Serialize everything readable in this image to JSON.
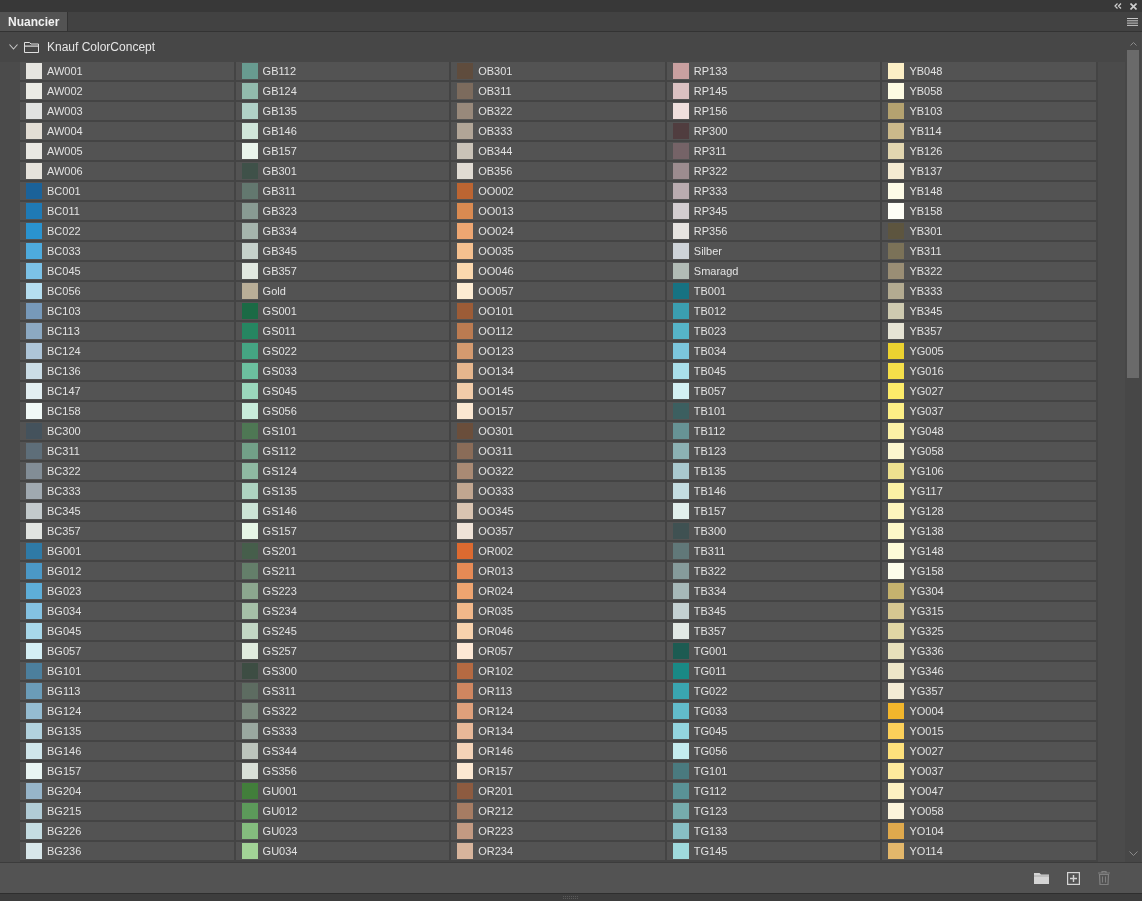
{
  "window": {
    "tabs": [
      {
        "label": "Nuancier",
        "selected": true
      }
    ]
  },
  "group": {
    "name": "Knauf ColorConcept",
    "expanded": true,
    "columns": [
      {
        "swatches": [
          {
            "name": "AW001",
            "color": "#e6e5e0"
          },
          {
            "name": "AW002",
            "color": "#ebebe5"
          },
          {
            "name": "AW003",
            "color": "#e1e2e1"
          },
          {
            "name": "AW004",
            "color": "#e3ded5"
          },
          {
            "name": "AW005",
            "color": "#e9e8e3"
          },
          {
            "name": "AW006",
            "color": "#e6e3dc"
          },
          {
            "name": "BC001",
            "color": "#1b6299"
          },
          {
            "name": "BC011",
            "color": "#1f7ab5"
          },
          {
            "name": "BC022",
            "color": "#2a93cf"
          },
          {
            "name": "BC033",
            "color": "#4eabdd"
          },
          {
            "name": "BC045",
            "color": "#7cc2e7"
          },
          {
            "name": "BC056",
            "color": "#b5def0"
          },
          {
            "name": "BC103",
            "color": "#7799b9"
          },
          {
            "name": "BC113",
            "color": "#8ca9c2"
          },
          {
            "name": "BC124",
            "color": "#aec5d8"
          },
          {
            "name": "BC136",
            "color": "#cbdde6"
          },
          {
            "name": "BC147",
            "color": "#e3eff2"
          },
          {
            "name": "BC158",
            "color": "#f1f9f7"
          },
          {
            "name": "BC300",
            "color": "#44525c"
          },
          {
            "name": "BC311",
            "color": "#5e6e79"
          },
          {
            "name": "BC322",
            "color": "#828d96"
          },
          {
            "name": "BC333",
            "color": "#a0a9b0"
          },
          {
            "name": "BC345",
            "color": "#c3cacc"
          },
          {
            "name": "BC357",
            "color": "#e1e4e1"
          },
          {
            "name": "BG001",
            "color": "#2f7aa6"
          },
          {
            "name": "BG012",
            "color": "#4b98c6"
          },
          {
            "name": "BG023",
            "color": "#5eaed8"
          },
          {
            "name": "BG034",
            "color": "#84c2e2"
          },
          {
            "name": "BG045",
            "color": "#a8d8ea"
          },
          {
            "name": "BG057",
            "color": "#d4eff5"
          },
          {
            "name": "BG101",
            "color": "#4c7f9d"
          },
          {
            "name": "BG113",
            "color": "#6b9cb8"
          },
          {
            "name": "BG124",
            "color": "#95bcd1"
          },
          {
            "name": "BG135",
            "color": "#b2d2de"
          },
          {
            "name": "BG146",
            "color": "#d0e6eb"
          },
          {
            "name": "BG157",
            "color": "#e9f5f3"
          },
          {
            "name": "BG204",
            "color": "#97b5c9"
          },
          {
            "name": "BG215",
            "color": "#b1ccd6"
          },
          {
            "name": "BG226",
            "color": "#c5dde2"
          },
          {
            "name": "BG236",
            "color": "#d8e7ea"
          }
        ]
      },
      {
        "swatches": [
          {
            "name": "GB112",
            "color": "#689b90"
          },
          {
            "name": "GB124",
            "color": "#92bbad"
          },
          {
            "name": "GB135",
            "color": "#b0d1c7"
          },
          {
            "name": "GB146",
            "color": "#d0e6da"
          },
          {
            "name": "GB157",
            "color": "#eaf5ec"
          },
          {
            "name": "GB301",
            "color": "#3f5149"
          },
          {
            "name": "GB311",
            "color": "#63786f"
          },
          {
            "name": "GB323",
            "color": "#899b93"
          },
          {
            "name": "GB334",
            "color": "#a6b5ad"
          },
          {
            "name": "GB345",
            "color": "#c6d1cb"
          },
          {
            "name": "GB357",
            "color": "#e1e8e0"
          },
          {
            "name": "Gold",
            "color": "#b9ae98"
          },
          {
            "name": "GS001",
            "color": "#1b6a45"
          },
          {
            "name": "GS011",
            "color": "#268661"
          },
          {
            "name": "GS022",
            "color": "#45a583"
          },
          {
            "name": "GS033",
            "color": "#6cc09f"
          },
          {
            "name": "GS045",
            "color": "#9bd8bd"
          },
          {
            "name": "GS056",
            "color": "#c8ecdb"
          },
          {
            "name": "GS101",
            "color": "#4e7754"
          },
          {
            "name": "GS112",
            "color": "#72a088"
          },
          {
            "name": "GS124",
            "color": "#8fb9a2"
          },
          {
            "name": "GS135",
            "color": "#aed3c1"
          },
          {
            "name": "GS146",
            "color": "#cce4d6"
          },
          {
            "name": "GS157",
            "color": "#e6f6e6"
          },
          {
            "name": "GS201",
            "color": "#465e4b"
          },
          {
            "name": "GS211",
            "color": "#647f6a"
          },
          {
            "name": "GS223",
            "color": "#8ca78f"
          },
          {
            "name": "GS234",
            "color": "#a6c0a8"
          },
          {
            "name": "GS245",
            "color": "#c3d7c5"
          },
          {
            "name": "GS257",
            "color": "#e0ebde"
          },
          {
            "name": "GS300",
            "color": "#3d4d43"
          },
          {
            "name": "GS311",
            "color": "#5d6c61"
          },
          {
            "name": "GS322",
            "color": "#7b8a7e"
          },
          {
            "name": "GS333",
            "color": "#9aa8a0"
          },
          {
            "name": "GS344",
            "color": "#bcc4bc"
          },
          {
            "name": "GS356",
            "color": "#d9e0d8"
          },
          {
            "name": "GU001",
            "color": "#427e3b"
          },
          {
            "name": "GU012",
            "color": "#5c9a5a"
          },
          {
            "name": "GU023",
            "color": "#84bd7e"
          },
          {
            "name": "GU034",
            "color": "#a2d397"
          }
        ]
      },
      {
        "swatches": [
          {
            "name": "OB301",
            "color": "#5f4c3d"
          },
          {
            "name": "OB311",
            "color": "#7c6b5d"
          },
          {
            "name": "OB322",
            "color": "#98897b"
          },
          {
            "name": "OB333",
            "color": "#b1a597"
          },
          {
            "name": "OB344",
            "color": "#cac3b8"
          },
          {
            "name": "OB356",
            "color": "#e0dbd3"
          },
          {
            "name": "OO002",
            "color": "#bc6532"
          },
          {
            "name": "OO013",
            "color": "#d98a51"
          },
          {
            "name": "OO024",
            "color": "#eda672"
          },
          {
            "name": "OO035",
            "color": "#f5c08f"
          },
          {
            "name": "OO046",
            "color": "#fbd8ae"
          },
          {
            "name": "OO057",
            "color": "#fdecd3"
          },
          {
            "name": "OO101",
            "color": "#9c5c37"
          },
          {
            "name": "OO112",
            "color": "#bb7b51"
          },
          {
            "name": "OO123",
            "color": "#d49a6f"
          },
          {
            "name": "OO134",
            "color": "#e6b68d"
          },
          {
            "name": "OO145",
            "color": "#f2cca9"
          },
          {
            "name": "OO157",
            "color": "#fbe7d1"
          },
          {
            "name": "OO301",
            "color": "#6a4e3b"
          },
          {
            "name": "OO311",
            "color": "#8a6c58"
          },
          {
            "name": "OO322",
            "color": "#a98a74"
          },
          {
            "name": "OO333",
            "color": "#c1a690"
          },
          {
            "name": "OO345",
            "color": "#d9c4b1"
          },
          {
            "name": "OO357",
            "color": "#efe3d8"
          },
          {
            "name": "OR002",
            "color": "#dc6a30"
          },
          {
            "name": "OR013",
            "color": "#e68a55"
          },
          {
            "name": "OR024",
            "color": "#eea470"
          },
          {
            "name": "OR035",
            "color": "#f2b88a"
          },
          {
            "name": "OR046",
            "color": "#f8d2ad"
          },
          {
            "name": "OR057",
            "color": "#fde8d5"
          },
          {
            "name": "OR102",
            "color": "#b56a42"
          },
          {
            "name": "OR113",
            "color": "#cf8660"
          },
          {
            "name": "OR124",
            "color": "#dfa07b"
          },
          {
            "name": "OR134",
            "color": "#e8b898"
          },
          {
            "name": "OR146",
            "color": "#f4d3b8"
          },
          {
            "name": "OR157",
            "color": "#fce8d2"
          },
          {
            "name": "OR201",
            "color": "#8d5b40"
          },
          {
            "name": "OR212",
            "color": "#a67c63"
          },
          {
            "name": "OR223",
            "color": "#c39a82"
          },
          {
            "name": "OR234",
            "color": "#d7b49c"
          }
        ]
      },
      {
        "swatches": [
          {
            "name": "RP133",
            "color": "#c9a0a0"
          },
          {
            "name": "RP145",
            "color": "#dbc1c2"
          },
          {
            "name": "RP156",
            "color": "#efdfdd"
          },
          {
            "name": "RP300",
            "color": "#503d3f"
          },
          {
            "name": "RP311",
            "color": "#756367"
          },
          {
            "name": "RP322",
            "color": "#9c8c8f"
          },
          {
            "name": "RP333",
            "color": "#b9abaf"
          },
          {
            "name": "RP345",
            "color": "#d3cdd0"
          },
          {
            "name": "RP356",
            "color": "#e6e3e0"
          },
          {
            "name": "Silber",
            "color": "#ced3d8"
          },
          {
            "name": "Smaragd",
            "color": "#b1bbb5"
          },
          {
            "name": "TB001",
            "color": "#177282"
          },
          {
            "name": "TB012",
            "color": "#3b9eb0"
          },
          {
            "name": "TB023",
            "color": "#56b4c8"
          },
          {
            "name": "TB034",
            "color": "#7cc6dc"
          },
          {
            "name": "TB045",
            "color": "#a9dfea"
          },
          {
            "name": "TB057",
            "color": "#d3f0f3"
          },
          {
            "name": "TB101",
            "color": "#3c5f60"
          },
          {
            "name": "TB112",
            "color": "#679395"
          },
          {
            "name": "TB123",
            "color": "#8cb1b3"
          },
          {
            "name": "TB135",
            "color": "#a9c9cf"
          },
          {
            "name": "TB146",
            "color": "#c4dde1"
          },
          {
            "name": "TB157",
            "color": "#e1efec"
          },
          {
            "name": "TB300",
            "color": "#3f5152"
          },
          {
            "name": "TB311",
            "color": "#617879"
          },
          {
            "name": "TB322",
            "color": "#869b9b"
          },
          {
            "name": "TB334",
            "color": "#a6b8b8"
          },
          {
            "name": "TB345",
            "color": "#c4d1d2"
          },
          {
            "name": "TB357",
            "color": "#e1e8e4"
          },
          {
            "name": "TG001",
            "color": "#1d5b52"
          },
          {
            "name": "TG011",
            "color": "#1a8985"
          },
          {
            "name": "TG022",
            "color": "#3aa5b0"
          },
          {
            "name": "TG033",
            "color": "#62bccb"
          },
          {
            "name": "TG045",
            "color": "#93d5df"
          },
          {
            "name": "TG056",
            "color": "#c4ebee"
          },
          {
            "name": "TG101",
            "color": "#4a7a7f"
          },
          {
            "name": "TG112",
            "color": "#5a9296"
          },
          {
            "name": "TG123",
            "color": "#76abac"
          },
          {
            "name": "TG133",
            "color": "#88bfc5"
          },
          {
            "name": "TG145",
            "color": "#9fdadd"
          }
        ]
      },
      {
        "swatches": [
          {
            "name": "YB048",
            "color": "#fcefc6"
          },
          {
            "name": "YB058",
            "color": "#fdfbe3"
          },
          {
            "name": "YB103",
            "color": "#b4a270"
          },
          {
            "name": "YB114",
            "color": "#cbb98b"
          },
          {
            "name": "YB126",
            "color": "#e2d6b0"
          },
          {
            "name": "YB137",
            "color": "#f4ead1"
          },
          {
            "name": "YB148",
            "color": "#fdfbe7"
          },
          {
            "name": "YB158",
            "color": "#fefef6"
          },
          {
            "name": "YB301",
            "color": "#5d553f"
          },
          {
            "name": "YB311",
            "color": "#7b7258"
          },
          {
            "name": "YB322",
            "color": "#9a8e75"
          },
          {
            "name": "YB333",
            "color": "#b3ab91"
          },
          {
            "name": "YB345",
            "color": "#cecab0"
          },
          {
            "name": "YB357",
            "color": "#e6e4d4"
          },
          {
            "name": "YG005",
            "color": "#ecd230"
          },
          {
            "name": "YG016",
            "color": "#f5df4a"
          },
          {
            "name": "YG027",
            "color": "#fdec6a"
          },
          {
            "name": "YG037",
            "color": "#fdef86"
          },
          {
            "name": "YG048",
            "color": "#fcf1a6"
          },
          {
            "name": "YG058",
            "color": "#fcf6ce"
          },
          {
            "name": "YG106",
            "color": "#ede08f"
          },
          {
            "name": "YG117",
            "color": "#fbf1a5"
          },
          {
            "name": "YG128",
            "color": "#fdf5bd"
          },
          {
            "name": "YG138",
            "color": "#fdf8c8"
          },
          {
            "name": "YG148",
            "color": "#fdfbd8"
          },
          {
            "name": "YG158",
            "color": "#fdfdeb"
          },
          {
            "name": "YG304",
            "color": "#c5b26e"
          },
          {
            "name": "YG315",
            "color": "#d6c791"
          },
          {
            "name": "YG325",
            "color": "#e0d6a4"
          },
          {
            "name": "YG336",
            "color": "#e7e0bb"
          },
          {
            "name": "YG346",
            "color": "#ede6c8"
          },
          {
            "name": "YG357",
            "color": "#f3ecd5"
          },
          {
            "name": "YO004",
            "color": "#f2b62c"
          },
          {
            "name": "YO015",
            "color": "#fcd05a"
          },
          {
            "name": "YO027",
            "color": "#fee17c"
          },
          {
            "name": "YO037",
            "color": "#feea9d"
          },
          {
            "name": "YO047",
            "color": "#fdf1c2"
          },
          {
            "name": "YO058",
            "color": "#fcf4db"
          },
          {
            "name": "YO104",
            "color": "#dfa94d"
          },
          {
            "name": "YO114",
            "color": "#e3b76b"
          }
        ]
      }
    ]
  },
  "footer": {
    "buttons": [
      {
        "kind": "new-group",
        "disabled": false
      },
      {
        "kind": "new-swatch",
        "disabled": false
      },
      {
        "kind": "delete",
        "disabled": true
      }
    ]
  }
}
